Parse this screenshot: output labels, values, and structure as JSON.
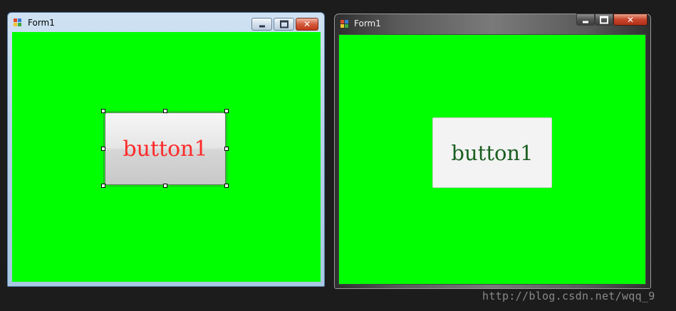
{
  "colors": {
    "form_back": "#00ff00",
    "designer_button_text": "#ff2a2a",
    "runtime_button_text": "#1b5e20",
    "desktop": "#1c1c1c"
  },
  "designer_window": {
    "title": "Form1",
    "icon": "winforms-app-icon",
    "caption_buttons": [
      "minimize-icon",
      "maximize-icon",
      "close-icon"
    ],
    "button": {
      "label": "button1",
      "selected": true
    }
  },
  "runtime_window": {
    "title": "Form1",
    "icon": "winforms-app-icon",
    "caption_buttons": [
      "minimize-icon",
      "maximize-icon",
      "close-icon"
    ],
    "button": {
      "label": "button1"
    }
  },
  "watermark": "http://blog.csdn.net/wqq_9"
}
